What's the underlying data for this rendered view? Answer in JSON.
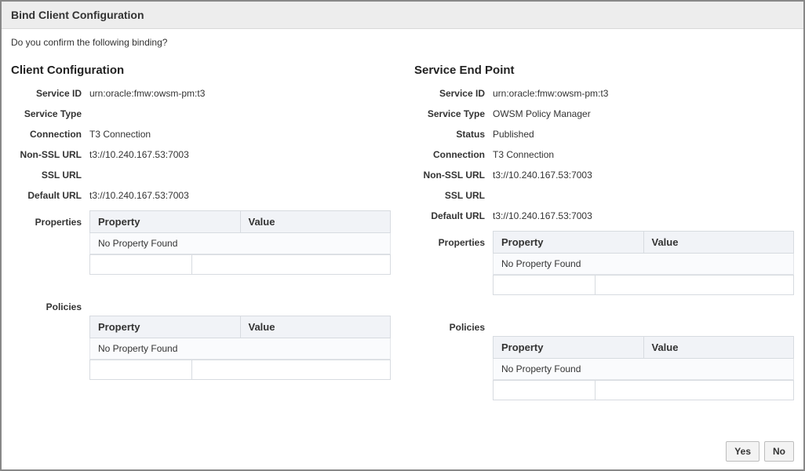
{
  "dialog": {
    "title": "Bind Client Configuration",
    "confirm_text": "Do you confirm the following binding?"
  },
  "labels": {
    "client_heading": "Client Configuration",
    "service_heading": "Service End Point",
    "service_id": "Service ID",
    "service_type": "Service Type",
    "status": "Status",
    "connection": "Connection",
    "non_ssl_url": "Non-SSL URL",
    "ssl_url": "SSL URL",
    "default_url": "Default URL",
    "properties": "Properties",
    "policies": "Policies",
    "col_property": "Property",
    "col_value": "Value",
    "no_property": "No Property Found"
  },
  "client": {
    "service_id": "urn:oracle:fmw:owsm-pm:t3",
    "service_type": "",
    "connection": "T3 Connection",
    "non_ssl_url": "t3://10.240.167.53:7003",
    "ssl_url": "",
    "default_url": "t3://10.240.167.53:7003"
  },
  "service": {
    "service_id": "urn:oracle:fmw:owsm-pm:t3",
    "service_type": "OWSM Policy Manager",
    "status": "Published",
    "connection": "T3 Connection",
    "non_ssl_url": "t3://10.240.167.53:7003",
    "ssl_url": "",
    "default_url": "t3://10.240.167.53:7003"
  },
  "buttons": {
    "yes": "Yes",
    "no": "No"
  }
}
